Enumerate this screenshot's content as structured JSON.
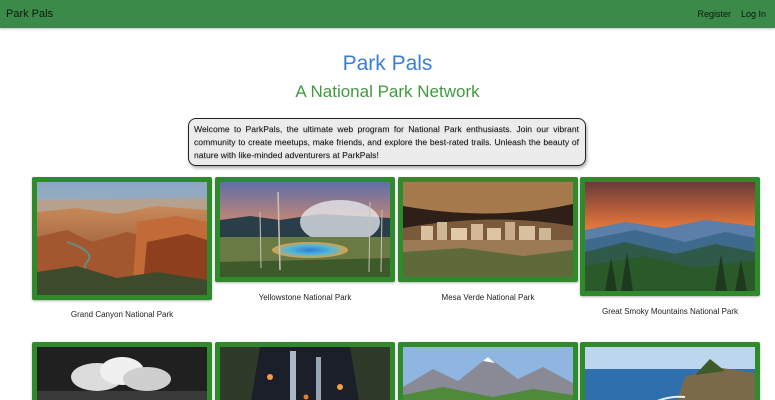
{
  "navbar": {
    "brand": "Park Pals",
    "links": [
      "Register",
      "Log In"
    ],
    "background_color": "#3b8a4a"
  },
  "header": {
    "title": "Park Pals",
    "subtitle": "A National Park Network",
    "title_color": "#3a7fd6",
    "subtitle_color": "#3f9a3f"
  },
  "intro": {
    "text": "Welcome to ParkPals, the ultimate web program for National Park enthusiasts. Join our vibrant community to create meetups, make friends, and explore the best-rated trails. Unleash the beauty of nature with like-minded adventurers at ParkPals!"
  },
  "parks": [
    {
      "name": "Grand Canyon National Park",
      "image": "grand-canyon-photo"
    },
    {
      "name": "Yellowstone National Park",
      "image": "yellowstone-hot-spring-photo"
    },
    {
      "name": "Mesa Verde National Park",
      "image": "mesa-verde-cliff-dwelling-photo"
    },
    {
      "name": "Great Smoky Mountains National Park",
      "image": "smoky-mountains-sunset-photo"
    },
    {
      "name": "",
      "image": "black-and-white-clouds-photo"
    },
    {
      "name": "",
      "image": "waterfall-night-photo"
    },
    {
      "name": "",
      "image": "mountain-valley-photo"
    },
    {
      "name": "",
      "image": "coastline-photo"
    }
  ],
  "frame_color": "#2e8a2b"
}
